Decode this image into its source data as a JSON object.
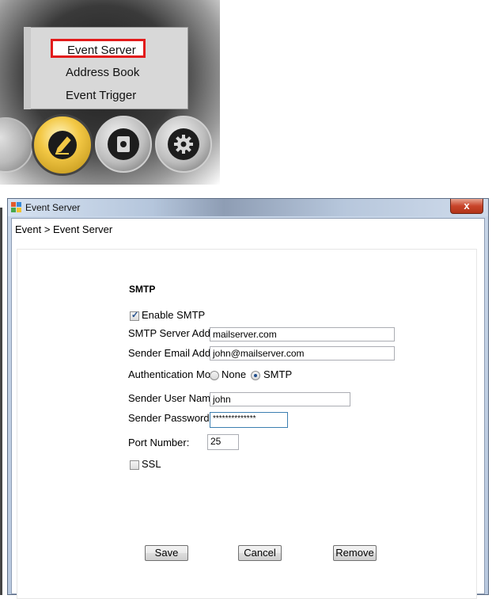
{
  "popup_menu": {
    "items": [
      {
        "label": "Event Server",
        "highlighted": true
      },
      {
        "label": "Address Book",
        "highlighted": false
      },
      {
        "label": "Event Trigger",
        "highlighted": false
      }
    ],
    "highlight_color": "#e21b1b"
  },
  "toolbar_icons": [
    "partial-round-icon",
    "pencil-icon",
    "log-book-icon",
    "gear-icon"
  ],
  "window": {
    "title": "Event Server",
    "close_glyph": "x",
    "breadcrumb": "Event > Event Server"
  },
  "form": {
    "section_title": "SMTP",
    "enable_smtp": {
      "label": "Enable SMTP",
      "checked": true
    },
    "smtp_server": {
      "label": "SMTP Server Addr",
      "value": "mailserver.com"
    },
    "sender_email": {
      "label": "Sender Email Addr",
      "value": "john@mailserver.com"
    },
    "auth_mode": {
      "label": "Authentication Mod",
      "options": [
        {
          "label": "None",
          "selected": false
        },
        {
          "label": "SMTP",
          "selected": true
        }
      ]
    },
    "sender_user": {
      "label": "Sender User Name",
      "value": "john"
    },
    "sender_password": {
      "label": "Sender Password:",
      "value": "**************"
    },
    "port": {
      "label": "Port Number:",
      "value": "25"
    },
    "ssl": {
      "label": "SSL",
      "checked": false
    }
  },
  "buttons": {
    "save": "Save",
    "cancel": "Cancel",
    "remove": "Remove"
  }
}
